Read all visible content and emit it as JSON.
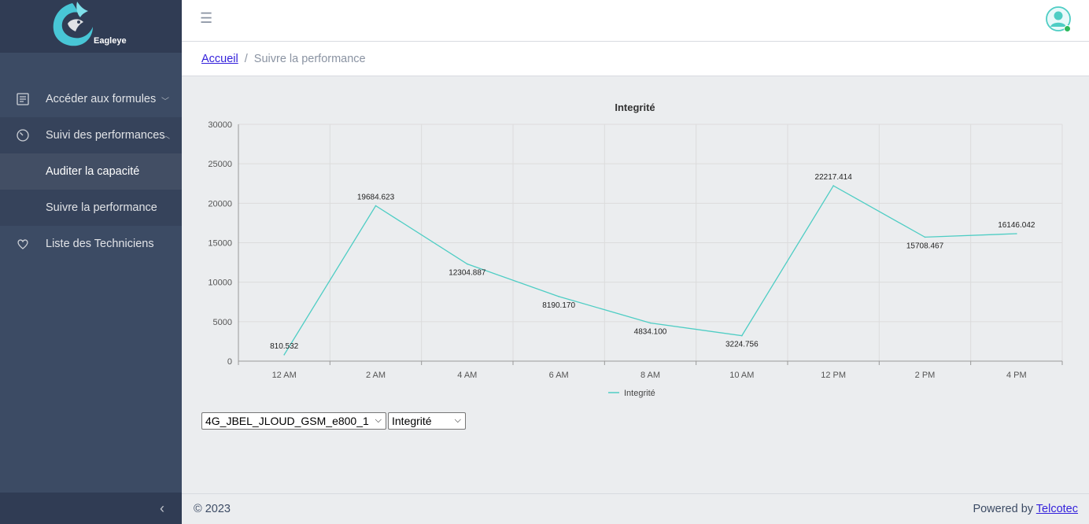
{
  "brand": {
    "name": "Eagleye"
  },
  "sidebar": {
    "items": [
      {
        "label": "Accéder aux formules",
        "icon": "form-icon"
      },
      {
        "label": "Suivi des performances",
        "icon": "speedometer-icon"
      },
      {
        "label": "Auditer la capacité"
      },
      {
        "label": "Suivre la performance"
      },
      {
        "label": "Liste des Techniciens",
        "icon": "hand-heart-icon"
      }
    ],
    "toggler": "‹"
  },
  "header": {
    "menu_icon": "☰"
  },
  "breadcrumb": {
    "home": "Accueil",
    "current": "Suivre la performance"
  },
  "chart_data": {
    "type": "line",
    "title": "Integrité",
    "categories": [
      "12 AM",
      "2 AM",
      "4 AM",
      "6 AM",
      "8 AM",
      "10 AM",
      "12 PM",
      "2 PM",
      "4 PM"
    ],
    "series": [
      {
        "name": "Integrité",
        "color": "#4ecdc4",
        "values": [
          810.532,
          19684.623,
          12304.887,
          8190.17,
          4834.1,
          3224.756,
          22217.414,
          15708.467,
          16146.042
        ],
        "labels": [
          "810.532",
          "19684.623",
          "12304.887",
          "8190.170",
          "4834.100",
          "3224.756",
          "22217.414",
          "15708.467",
          "16146.042"
        ]
      }
    ],
    "yticks": [
      "0",
      "5000",
      "10000",
      "15000",
      "20000",
      "25000",
      "30000"
    ],
    "ylim": [
      0,
      30000
    ],
    "grid": true,
    "legend": "bottom"
  },
  "controls": {
    "site_select": "4G_JBEL_JLOUD_GSM_e800_1",
    "metric_select": "Integrité"
  },
  "footer": {
    "copyright": "© 2023",
    "powered_prefix": "Powered by",
    "powered_link": "Telcotec"
  },
  "colors": {
    "sidebar": "#3c4b64",
    "brand_bg": "#303c54",
    "accent": "#4ecdc4",
    "link": "#321fdb"
  }
}
